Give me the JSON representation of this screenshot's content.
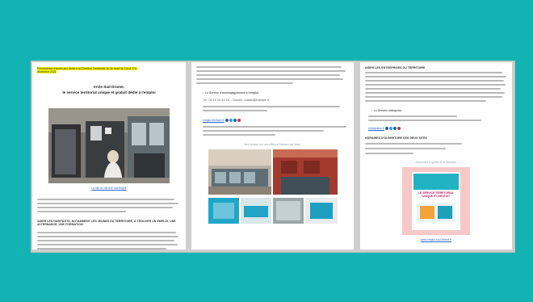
{
  "page1": {
    "highlight_line1": "Permanence d'accès aux droits à la Direction Territoriale du 3e lundi de 14h à 17h,",
    "highlight_line2": "décembre 2021",
    "title": "InVie Sud Drome,",
    "subtitle": "le service territorial unique et gratuit dédié à l'emploi",
    "photo_link": "Le site du service numérique",
    "section1": "AIDER LES HABITANTS, NOTAMMENT LES JEUNES DU TERRITOIRE, À TROUVER UN EMPLOI, UNE ALTERNANCE, UNE FORMATION"
  },
  "page2": {
    "bullet": "Le Service d'accompagnement à l'emploi",
    "phone": "Tél : 04 XX XX XX XX – Courriel : contact@exemple.fr",
    "web_link": "emploi-territoire.fr",
    "photo_caption": "Nos locaux, rue des Alliés à Romans-sur-Isère"
  },
  "page3": {
    "section1": "AIDER LES ENTREPRISES DU TERRITOIRE",
    "bullet": "Le Service entreprise",
    "web_link": "entreprises.fr",
    "section2": "HORAIRES D'OUVERTURE DES DEUX SITES",
    "poster_caption": "Retrouvez le guide de la Direction",
    "poster_title": "LE SERVICE TERRITORIAL UNIQUE ET GRATUIT",
    "link": "www.emploi-sud-drome.fr"
  },
  "colors": {
    "background": "#14b3b3",
    "highlight": "#f3f000",
    "link": "#2b62c9"
  }
}
